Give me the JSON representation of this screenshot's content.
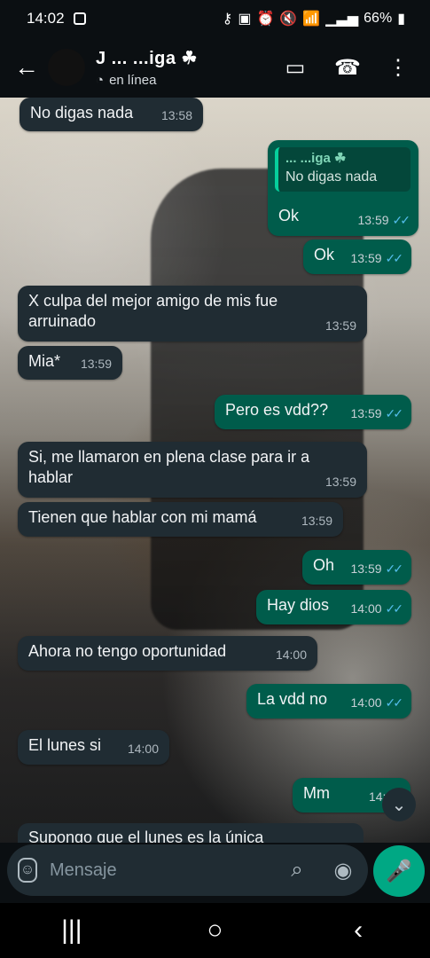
{
  "status": {
    "time": "14:02",
    "battery": "66%"
  },
  "header": {
    "contact_name": "J ... ...iga ☘",
    "presence": "en línea"
  },
  "messages": [
    {
      "side": "in",
      "text": "No digas nada",
      "time": "13:58"
    },
    {
      "side": "out",
      "text": "Ok",
      "time": "13:59",
      "quote_author": "... ...iga ☘",
      "quote_text": "No digas nada"
    },
    {
      "side": "out",
      "text": "Ok",
      "time": "13:59"
    },
    {
      "side": "in",
      "text": "X culpa del mejor amigo de mis fue arruinado",
      "time": "13:59"
    },
    {
      "side": "in",
      "text": "Mia*",
      "time": "13:59"
    },
    {
      "side": "out",
      "text": "Pero es vdd??",
      "time": "13:59"
    },
    {
      "side": "in",
      "text": "Si, me llamaron en plena clase para ir a hablar",
      "time": "13:59"
    },
    {
      "side": "in",
      "text": "Tienen que hablar con mi mamá",
      "time": "13:59"
    },
    {
      "side": "out",
      "text": "Oh",
      "time": "13:59"
    },
    {
      "side": "out",
      "text": "Hay dios",
      "time": "14:00"
    },
    {
      "side": "in",
      "text": "Ahora no tengo oportunidad",
      "time": "14:00"
    },
    {
      "side": "out",
      "text": "La vdd no",
      "time": "14:00"
    },
    {
      "side": "in",
      "text": "El lunes si",
      "time": "14:00"
    },
    {
      "side": "out",
      "text": "Mm",
      "time": "14:00"
    },
    {
      "side": "in",
      "text": "Supongo que el lunes es la única"
    }
  ],
  "composer": {
    "placeholder": "Mensaje"
  },
  "icons": {
    "back": "arrow-left-icon",
    "video": "video-call-icon",
    "phone": "voice-call-icon",
    "menu": "more-vertical-icon",
    "emoji": "emoji-icon",
    "attach": "paperclip-icon",
    "camera": "camera-icon",
    "mic": "microphone-icon",
    "scroll": "chevrons-down-icon"
  },
  "navigation": {
    "recent": "|||",
    "home": "○",
    "back": "‹"
  }
}
